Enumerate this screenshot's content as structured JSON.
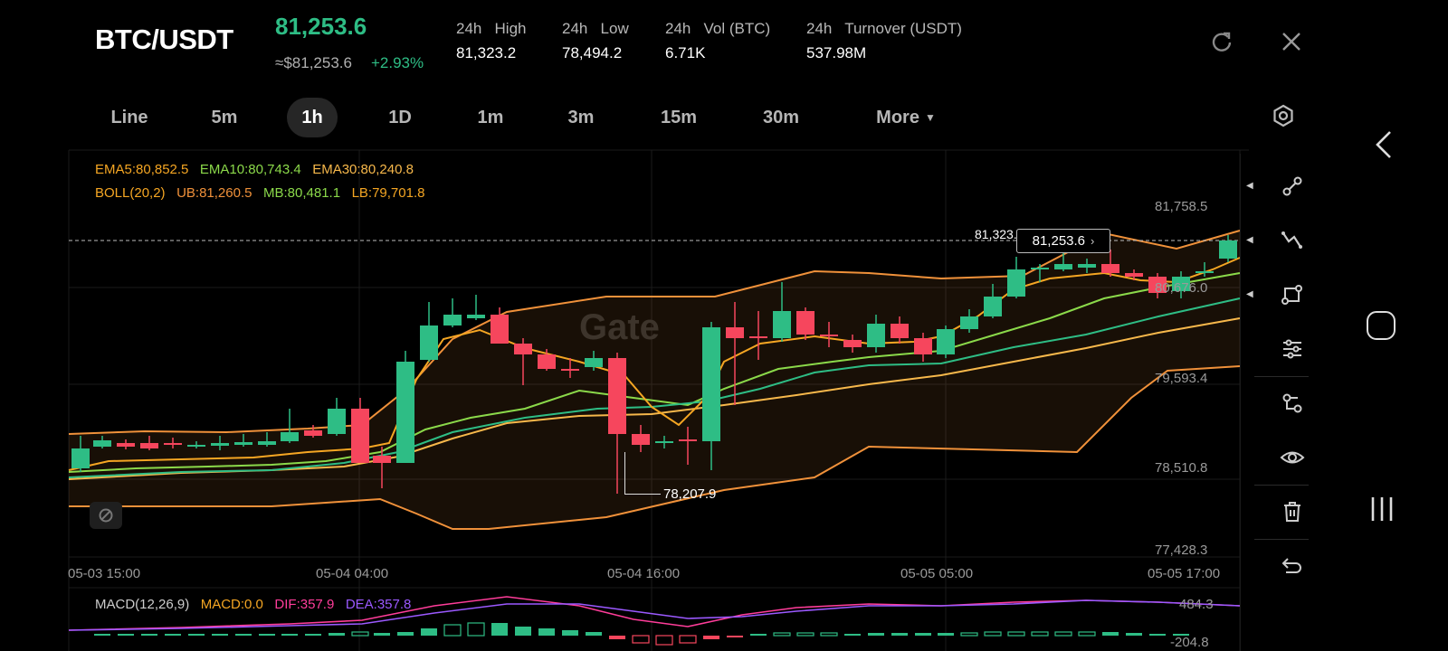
{
  "header": {
    "pair": "BTC/USDT",
    "price": "81,253.6",
    "approx_price": "≈$81,253.6",
    "change": "+2.93%",
    "stats": [
      {
        "label": "24h   High",
        "value": "81,323.2"
      },
      {
        "label": "24h   Low",
        "value": "78,494.2"
      },
      {
        "label": "24h   Vol (BTC)",
        "value": "6.71K"
      },
      {
        "label": "24h   Turnover (USDT)",
        "value": "537.98M"
      }
    ]
  },
  "timeframes": [
    "Line",
    "5m",
    "1h",
    "1D",
    "1m",
    "3m",
    "15m",
    "30m",
    "More"
  ],
  "active_timeframe": "1h",
  "indicators": {
    "ema5": "EMA5:80,852.5",
    "ema10": "EMA10:80,743.4",
    "ema30": "EMA30:80,240.8",
    "boll": "BOLL(20,2)",
    "ub": "UB:81,260.5",
    "mb": "MB:80,481.1",
    "lb": "LB:79,701.8"
  },
  "price_axis": [
    "81,758.5",
    "80,676.0",
    "79,593.4",
    "78,510.8",
    "77,428.3"
  ],
  "time_axis": [
    "05-03 15:00",
    "05-04 04:00",
    "05-04 16:00",
    "05-05 05:00",
    "05-05 17:00"
  ],
  "high_marker": "81,323.2",
  "current_price_tag": "81,253.6",
  "low_marker": "78,207.9",
  "macd": {
    "title": "MACD(12,26,9)",
    "macd": "MACD:0.0",
    "dif": "DIF:357.9",
    "dea": "DEA:357.8",
    "axis_top": "484.3",
    "axis_bottom": "-204.8"
  },
  "colors": {
    "up": "#2ebd85",
    "down": "#f6465d",
    "ema5": "#f5a623",
    "ema10": "#8bd94a",
    "ema30": "#f7b84b",
    "boll": "#f0913a",
    "dif": "#ff3d9a",
    "dea": "#9b59ff"
  }
}
